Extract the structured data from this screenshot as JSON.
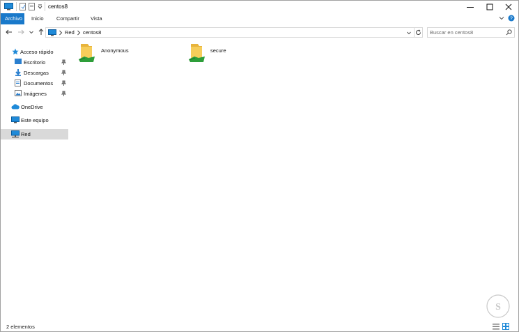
{
  "window": {
    "title": "centos8",
    "quick_access_toolbar": [
      "properties-icon",
      "new-folder-icon",
      "customize-dropdown-icon"
    ]
  },
  "ribbon": {
    "tabs": [
      {
        "label": "Archivo",
        "active": true
      },
      {
        "label": "Inicio",
        "active": false
      },
      {
        "label": "Compartir",
        "active": false
      },
      {
        "label": "Vista",
        "active": false
      }
    ]
  },
  "address_bar": {
    "path": [
      "Red",
      "centos8"
    ],
    "search_placeholder": "Buscar en centos8"
  },
  "sidebar": {
    "quick_access_label": "Acceso rápido",
    "items": [
      {
        "label": "Escritorio",
        "icon": "desktop-icon",
        "pinned": true
      },
      {
        "label": "Descargas",
        "icon": "downloads-icon",
        "pinned": true
      },
      {
        "label": "Documentos",
        "icon": "documents-icon",
        "pinned": true
      },
      {
        "label": "Imágenes",
        "icon": "pictures-icon",
        "pinned": true
      }
    ],
    "onedrive_label": "OneDrive",
    "this_pc_label": "Este equipo",
    "network_label": "Red",
    "selected": "Red"
  },
  "files": [
    {
      "name": "Anonymous",
      "type": "shared-folder"
    },
    {
      "name": "secure",
      "type": "shared-folder"
    }
  ],
  "status": {
    "item_count": "2 elementos"
  },
  "colors": {
    "accent": "#1979ca",
    "folder": "#f3c850",
    "share_green": "#2e9e3a",
    "selection": "#d9d9d9"
  }
}
